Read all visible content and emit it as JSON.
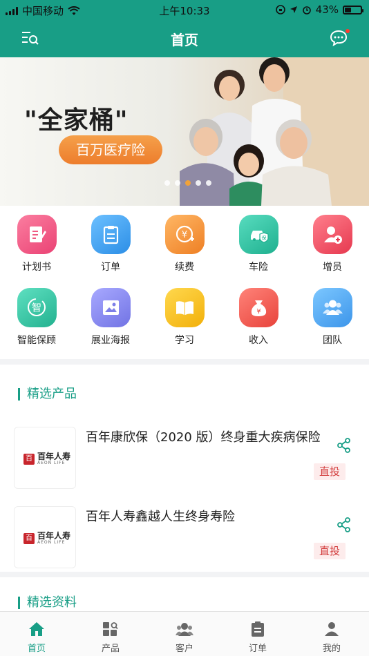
{
  "status": {
    "carrier": "中国移动",
    "time": "上午10:33",
    "battery_text": "43%",
    "battery_level": 0.43
  },
  "header": {
    "title": "首页",
    "left_icon": "list-search-icon",
    "right_icon": "message-icon",
    "color": "#189e86"
  },
  "banner": {
    "headline": "\"全家桶\"",
    "pill": "百万医疗险",
    "dots_count": 5,
    "active_dot": 2
  },
  "grid": [
    {
      "label": "计划书",
      "icon": "plan-icon",
      "color": "#f25a82"
    },
    {
      "label": "订单",
      "icon": "order-icon",
      "color": "#48a6ee"
    },
    {
      "label": "续费",
      "icon": "renew-icon",
      "color": "#f39a3e"
    },
    {
      "label": "车险",
      "icon": "car-insurance-icon",
      "color": "#2fc3a3"
    },
    {
      "label": "增员",
      "icon": "add-member-icon",
      "color": "#f2566b"
    },
    {
      "label": "智能保顾",
      "icon": "smart-advisor-icon",
      "color": "#3fcba8"
    },
    {
      "label": "展业海报",
      "icon": "poster-icon",
      "color": "#8d8ff0"
    },
    {
      "label": "学习",
      "icon": "study-icon",
      "color": "#f7c52b"
    },
    {
      "label": "收入",
      "icon": "income-icon",
      "color": "#f0605a"
    },
    {
      "label": "团队",
      "icon": "team-icon",
      "color": "#4ba9f0"
    }
  ],
  "products": {
    "section_title": "精选产品",
    "items": [
      {
        "name": "百年康欣保（2020 版）终身重大疾病保险",
        "tag": "直投",
        "logo_cn": "百年人寿",
        "logo_en": "AEON LIFE"
      },
      {
        "name": "百年人寿鑫越人生终身寿险",
        "tag": "直投",
        "logo_cn": "百年人寿",
        "logo_en": "AEON LIFE"
      }
    ]
  },
  "materials": {
    "section_title": "精选资料"
  },
  "tabbar": [
    {
      "label": "首页",
      "icon": "home-icon",
      "active": true
    },
    {
      "label": "产品",
      "icon": "product-icon",
      "active": false
    },
    {
      "label": "客户",
      "icon": "customer-icon",
      "active": false
    },
    {
      "label": "订单",
      "icon": "order-tab-icon",
      "active": false
    },
    {
      "label": "我的",
      "icon": "profile-icon",
      "active": false
    }
  ]
}
